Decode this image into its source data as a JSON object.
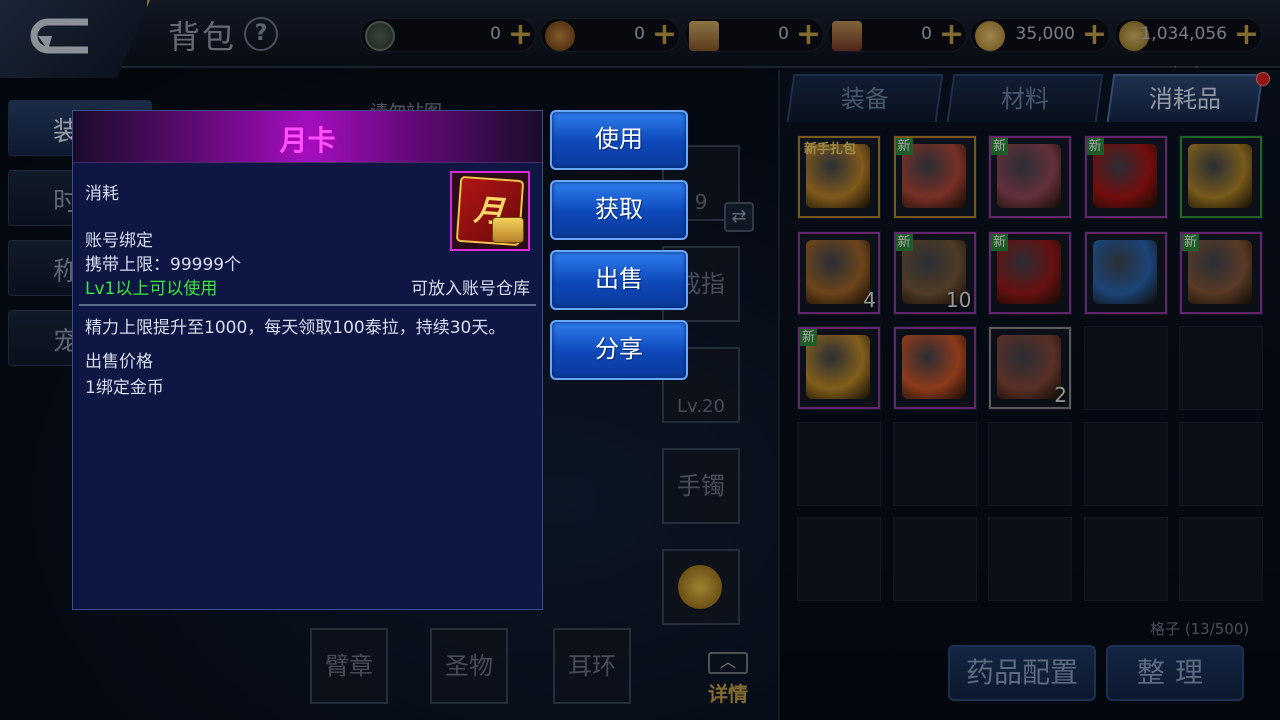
{
  "header": {
    "title": "背包",
    "currencies": [
      {
        "icon": "emblem-token-icon",
        "value": "0",
        "color": "#3a4a3e"
      },
      {
        "icon": "bronze-coin-icon",
        "value": "0",
        "color": "#8a5a22"
      },
      {
        "icon": "scroll-ticket-icon",
        "value": "0",
        "color": "#8a6a3a"
      },
      {
        "icon": "sealed-scroll-icon",
        "value": "0",
        "color": "#8a5a3a"
      },
      {
        "icon": "gold-coin-icon",
        "value": "35,000",
        "color": "#c9a34a"
      },
      {
        "icon": "bound-gold-icon",
        "value": "1,034,056",
        "color": "#b89a42"
      }
    ]
  },
  "left_tabs": [
    "装",
    "时",
    "称",
    "宠"
  ],
  "equipment": {
    "cover_text": "请勿站图",
    "ring_label": "戒指",
    "bracelet_label": "手镯",
    "armband_label": "臂章",
    "relic_label": "圣物",
    "earring_label": "耳环",
    "weapon_level": "9",
    "pet_level": "Lv.20",
    "details_label": "详情"
  },
  "inventory": {
    "tabs": [
      "装备",
      "材料",
      "消耗品"
    ],
    "active_tab": 2,
    "slot_count": "格子 (13/500)",
    "items": [
      {
        "name": "newbie-gift-chest",
        "new": false,
        "label": "新手扎包",
        "qty": "",
        "rim": "#b8862a",
        "color": "#c68a2a"
      },
      {
        "name": "red-scroll",
        "new": true,
        "label": "",
        "qty": "",
        "rim": "#b8862a",
        "color": "#b84a3a"
      },
      {
        "name": "purple-scroll",
        "new": true,
        "label": "",
        "qty": "",
        "rim": "#9a3aa8",
        "color": "#9a4a5a"
      },
      {
        "name": "month-card",
        "new": true,
        "label": "",
        "qty": "",
        "rim": "#9a3aa8",
        "color": "#b11515"
      },
      {
        "name": "golden-box",
        "new": false,
        "label": "",
        "qty": "",
        "rim": "#2e9a3a",
        "color": "#b88a2a"
      },
      {
        "name": "hammer",
        "new": false,
        "label": "",
        "qty": "4",
        "rim": "#9a3aa8",
        "color": "#a86a2a"
      },
      {
        "name": "open-chest",
        "new": true,
        "label": "",
        "qty": "10",
        "rim": "#9a3aa8",
        "color": "#7a5a3a"
      },
      {
        "name": "red-crest",
        "new": true,
        "label": "",
        "qty": "",
        "rim": "#9a3aa8",
        "color": "#a01a1a"
      },
      {
        "name": "blue-tag",
        "new": false,
        "label": "",
        "qty": "",
        "rim": "#9a3aa8",
        "color": "#2a6ab8"
      },
      {
        "name": "brown-scroll",
        "new": true,
        "label": "",
        "qty": "",
        "rim": "#9a3aa8",
        "color": "#8a5a3a"
      },
      {
        "name": "gold-card",
        "new": true,
        "label": "",
        "qty": "",
        "rim": "#9a3aa8",
        "color": "#c9922a"
      },
      {
        "name": "heart-book",
        "new": false,
        "label": "",
        "qty": "",
        "rim": "#9a3aa8",
        "color": "#d85a2a"
      },
      {
        "name": "dragon-statue",
        "new": false,
        "label": "",
        "qty": "2",
        "rim": "#8a8a8a",
        "color": "#8a4a3a"
      }
    ],
    "empty_cells": 12,
    "new_badge": "新",
    "buttons": {
      "potion_config": "药品配置",
      "sort": "整理"
    }
  },
  "tooltip": {
    "title": "月卡",
    "category": "消耗",
    "binding": "账号绑定",
    "carry_limit": "携带上限：99999个",
    "usable_level": "Lv1以上可以使用",
    "storage": "可放入账号仓库",
    "description": "精力上限提升至1000，每天领取100泰拉，持续30天。",
    "sell_price_label": "出售价格",
    "sell_price_value": "1绑定金币",
    "icon_char": "月",
    "title_color": "#ff52ff",
    "usable_color": "#38e83a"
  },
  "actions": [
    "使用",
    "获取",
    "出售",
    "分享"
  ]
}
